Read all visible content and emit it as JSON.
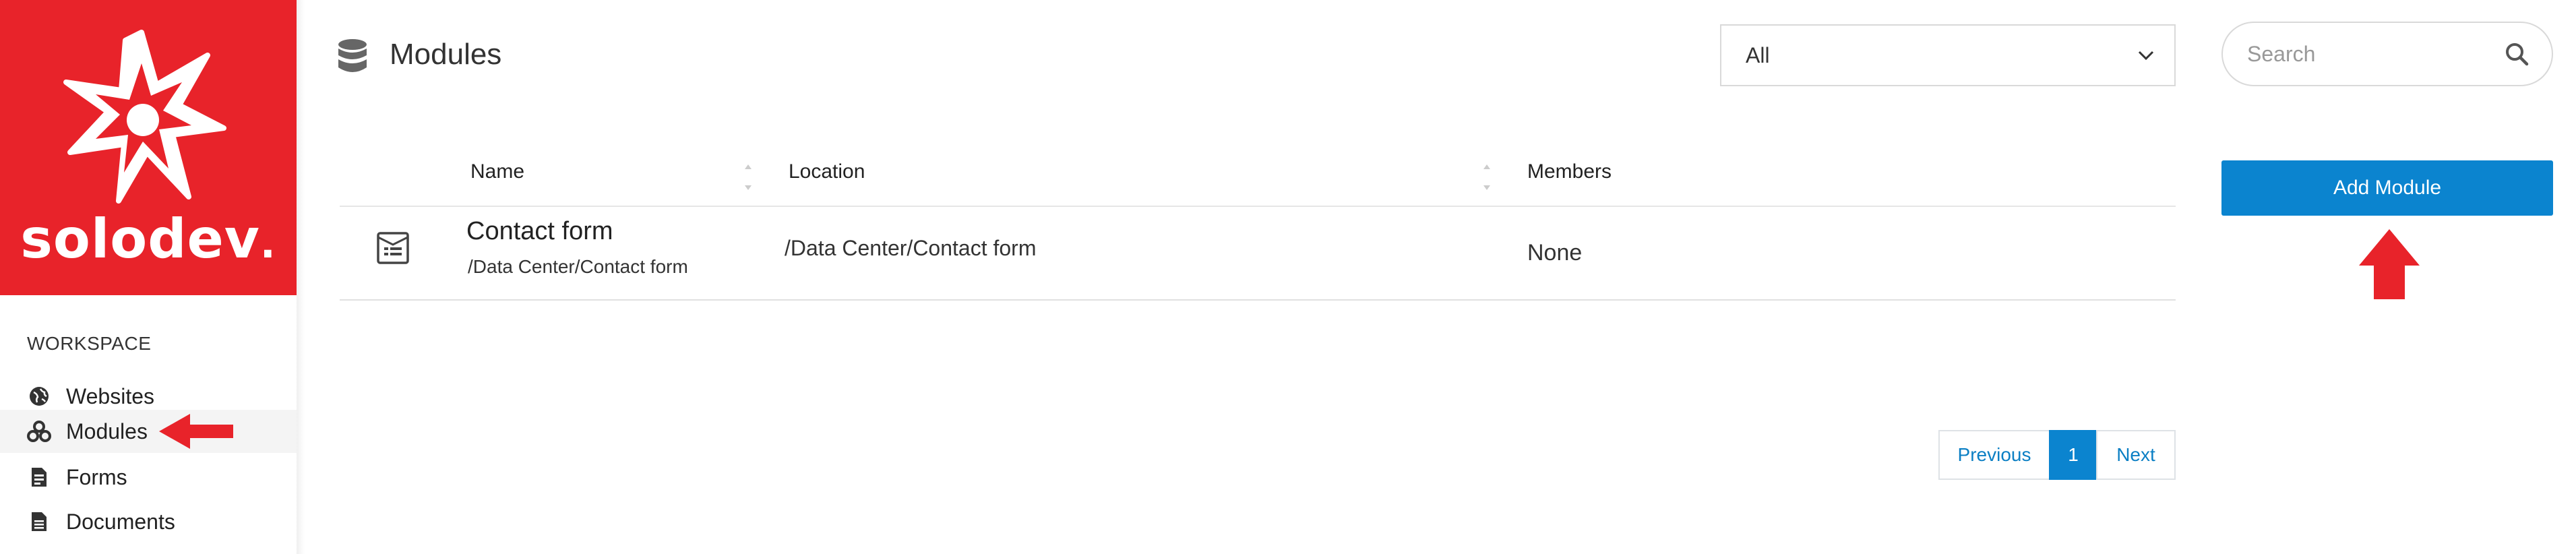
{
  "brand": {
    "name": "solodev",
    "accent": "#e8232a",
    "primary": "#0b84cf"
  },
  "sidebar": {
    "section_label": "WORKSPACE",
    "items": [
      {
        "label": "Websites",
        "icon": "globe-icon",
        "active": false
      },
      {
        "label": "Modules",
        "icon": "cubes-icon",
        "active": true
      },
      {
        "label": "Forms",
        "icon": "form-icon",
        "active": false
      },
      {
        "label": "Documents",
        "icon": "document-icon",
        "active": false
      }
    ]
  },
  "header": {
    "title": "Modules",
    "icon": "database-icon",
    "filter": {
      "selected": "All"
    },
    "search": {
      "placeholder": "Search"
    }
  },
  "table": {
    "columns": [
      "Name",
      "Location",
      "Members"
    ],
    "rows": [
      {
        "icon": "module-icon",
        "name": "Contact form",
        "path": "/Data Center/Contact form",
        "location": "/Data Center/Contact form",
        "members": "None"
      }
    ]
  },
  "pagination": {
    "previous": "Previous",
    "current": "1",
    "next": "Next"
  },
  "actions": {
    "add_module": "Add Module"
  }
}
